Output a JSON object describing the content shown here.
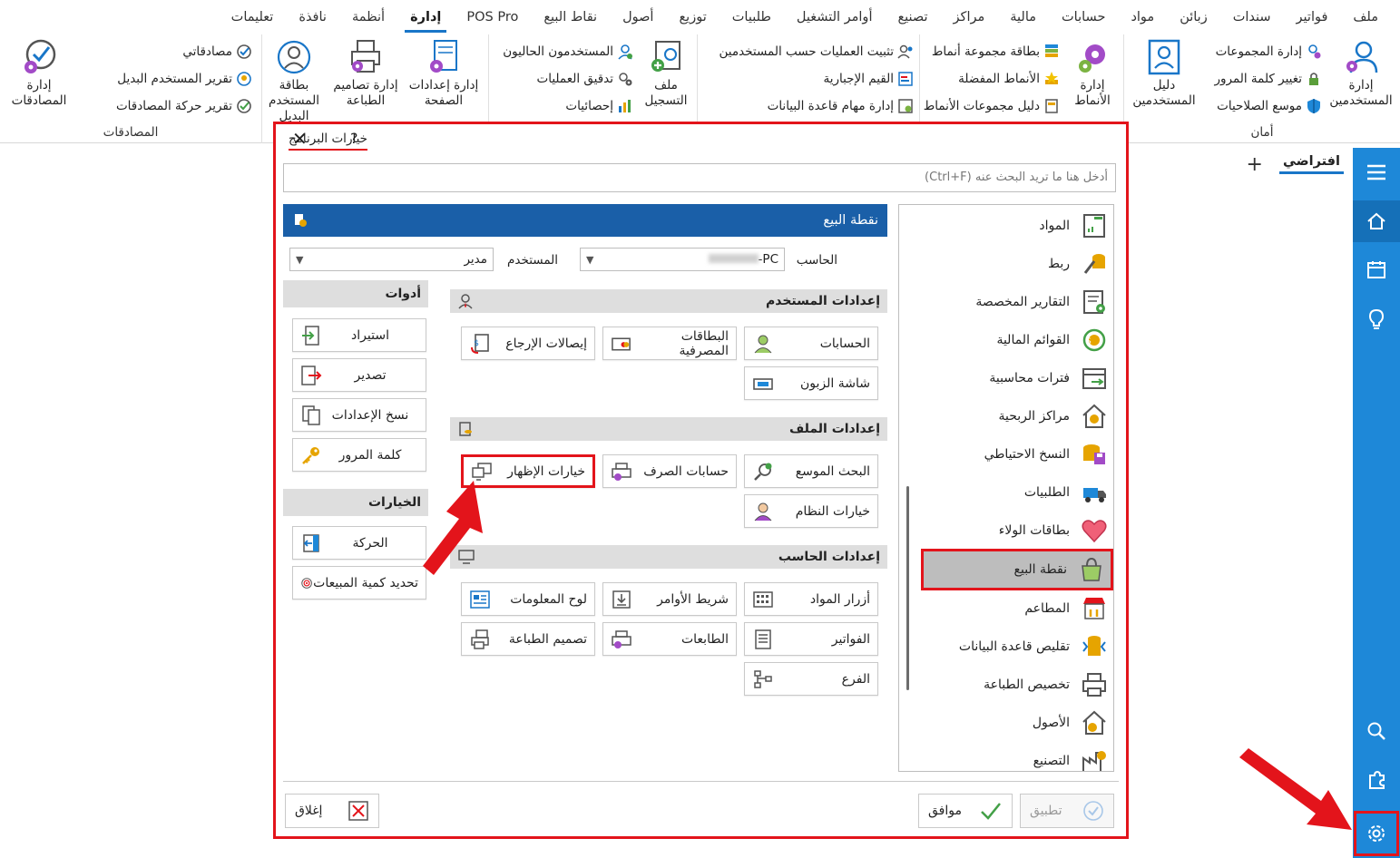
{
  "menu": [
    "ملف",
    "فواتير",
    "سندات",
    "زبائن",
    "مواد",
    "حسابات",
    "مالية",
    "مراكز",
    "تصنيع",
    "أوامر التشغيل",
    "طلبيات",
    "توزيع",
    "أصول",
    "نقاط البيع",
    "POS Pro",
    "إدارة",
    "أنظمة",
    "نافذة",
    "تعليمات"
  ],
  "ribbon": {
    "security": {
      "title": "أمان",
      "manage_users": "إدارة المستخدمين",
      "manage_groups": "إدارة المجموعات",
      "change_password": "تغيير كلمة المرور",
      "permissions_wizard": "موسع الصلاحيات",
      "users_guide": "دليل المستخدمين"
    },
    "patterns": {
      "manage_patterns": "إدارة الأنماط",
      "pattern_group_card": "بطاقة مجموعة أنماط",
      "favorite_patterns": "الأنماط المفضلة",
      "pattern_groups_guide": "دليل مجموعات الأنماط"
    },
    "db": {
      "fix_ops_by_user": "تثبيت العمليات حسب المستخدمين",
      "mandatory_values": "القيم الإجبارية",
      "db_tasks": "إدارة مهام قاعدة البيانات"
    },
    "log": {
      "log_file": "ملف التسجيل",
      "current_users": "المستخدمون الحاليون",
      "ops_audit": "تدقيق العمليات",
      "statistics": "إحصائيات"
    },
    "page": {
      "page_settings": "إدارة إعدادات الصفحة",
      "print_designs": "إدارة تصاميم الطباعة",
      "alt_user_card": "بطاقة المستخدم البديل"
    },
    "auth": {
      "title": "المصادقات",
      "my_approvals": "مصادقاتي",
      "alt_user_report": "تقرير المستخدم البديل",
      "auth_movement_report": "تقرير حركة المصادقات",
      "manage_auth": "إدارة المصادقات"
    }
  },
  "tab": {
    "default": "افتراضي",
    "add": "+"
  },
  "dialog": {
    "title": "خيارات البرنامج",
    "help": "?",
    "close": "✕",
    "search_placeholder": "أدخل هنا ما تريد البحث عنه (Ctrl+F)",
    "categories": [
      "المواد",
      "ربط",
      "التقارير المخصصة",
      "القوائم المالية",
      "فترات محاسبية",
      "مراكز الربحية",
      "النسخ الاحتياطي",
      "الطلبيات",
      "بطاقات الولاء",
      "نقطة البيع",
      "المطاعم",
      "تقليص قاعدة البيانات",
      "تخصيص الطباعة",
      "الأصول",
      "التصنيع"
    ],
    "panel_title": "نقطة البيع",
    "computer_label": "الحاسب",
    "computer_value": "PC-",
    "user_label": "المستخدم",
    "user_value": "مدير",
    "user_settings": {
      "title": "إعدادات المستخدم",
      "accounts": "الحسابات",
      "bank_cards": "البطاقات المصرفية",
      "return_receipts": "إيصالات الإرجاع",
      "customer_screen": "شاشة الزبون"
    },
    "file_settings": {
      "title": "إعدادات الملف",
      "extended_search": "البحث الموسع",
      "exchange_accounts": "حسابات الصرف",
      "display_options": "خيارات الإظهار",
      "system_options": "خيارات النظام"
    },
    "computer_settings": {
      "title": "إعدادات الحاسب",
      "item_buttons": "أزرار المواد",
      "toolbar": "شريط الأوامر",
      "info_board": "لوح المعلومات",
      "invoices": "الفواتير",
      "printers": "الطابعات",
      "print_design": "تصميم الطباعة",
      "branch": "الفرع"
    },
    "tools": {
      "title": "أدوات",
      "import": "استيراد",
      "export": "تصدير",
      "copy_settings": "نسخ الإعدادات",
      "password": "كلمة المرور"
    },
    "options": {
      "title": "الخيارات",
      "movement": "الحركة",
      "sales_qty": "تحديد كمية المبيعات"
    },
    "apply": "تطبيق",
    "ok": "موافق",
    "close_btn": "إغلاق"
  },
  "colors": {
    "accent": "#1976c8",
    "sidebar": "#1e88d8",
    "panel_header": "#1a5fa8",
    "highlight_red": "#e3141b"
  }
}
